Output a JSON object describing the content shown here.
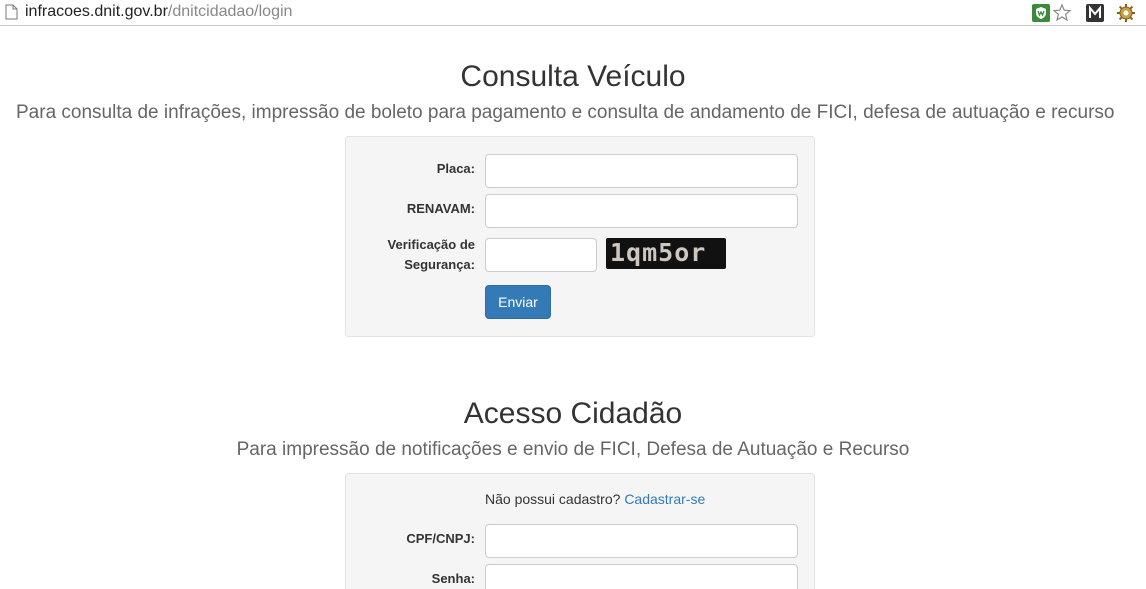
{
  "browser": {
    "url_host": "infracoes.dnit.gov.br",
    "url_path": "/dnitcidadao/login"
  },
  "consulta": {
    "title": "Consulta Veículo",
    "subtitle": "Para consulta de infrações, impressão de boleto para pagamento e consulta de andamento de FICI, defesa de autuação e recurso",
    "placa_label": "Placa:",
    "renavam_label": "RENAVAM:",
    "verificacao_label_line1": "Verificação de",
    "verificacao_label_line2": "Segurança:",
    "captcha_text": "1qm5or",
    "submit_label": "Enviar"
  },
  "acesso": {
    "title": "Acesso Cidadão",
    "subtitle": "Para impressão de notificações e envio de FICI, Defesa de Autuação e Recurso",
    "no_account_text": "Não possui cadastro?",
    "register_link": "Cadastrar-se",
    "cpf_label": "CPF/CNPJ:",
    "senha_label": "Senha:"
  }
}
